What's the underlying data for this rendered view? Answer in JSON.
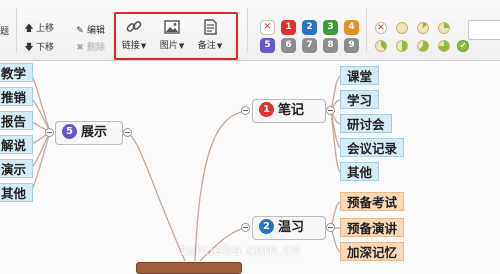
{
  "toolbar": {
    "left_fragment": "题",
    "move_up": "上移",
    "move_down": "下移",
    "edit": "编辑",
    "delete": "删除",
    "link_label": "链接",
    "image_label": "图片",
    "note_label": "备注",
    "priorities": [
      "1",
      "2",
      "3",
      "4",
      "5",
      "6",
      "7",
      "8",
      "9"
    ],
    "priority_colors": [
      "#e2302f",
      "#2973c7",
      "#3c9a3a",
      "#e39126",
      "#6b54c9",
      "#8d8d8d",
      "#8d8d8d",
      "#8d8d8d",
      "#8d8d8d"
    ]
  },
  "mindmap": {
    "left_branch": {
      "badge": "5",
      "title": "展示",
      "children": [
        "教学",
        "推销",
        "报告",
        "解说",
        "演示",
        "其他"
      ]
    },
    "right_branch_notes": {
      "badge": "1",
      "title": "笔记",
      "children": [
        "课堂",
        "学习",
        "研讨会",
        "会议记录",
        "其他"
      ]
    },
    "right_branch_review": {
      "badge": "2",
      "title": "温习",
      "children": [
        "预备考试",
        "预备演讲",
        "加深记忆"
      ]
    }
  },
  "watermark": "tuhuaba.com.cn",
  "colors": {
    "highlight": "#e12424",
    "node_blue": "#d7ebf5",
    "node_orange": "#f7d8b8",
    "line": "#c9a89a"
  }
}
